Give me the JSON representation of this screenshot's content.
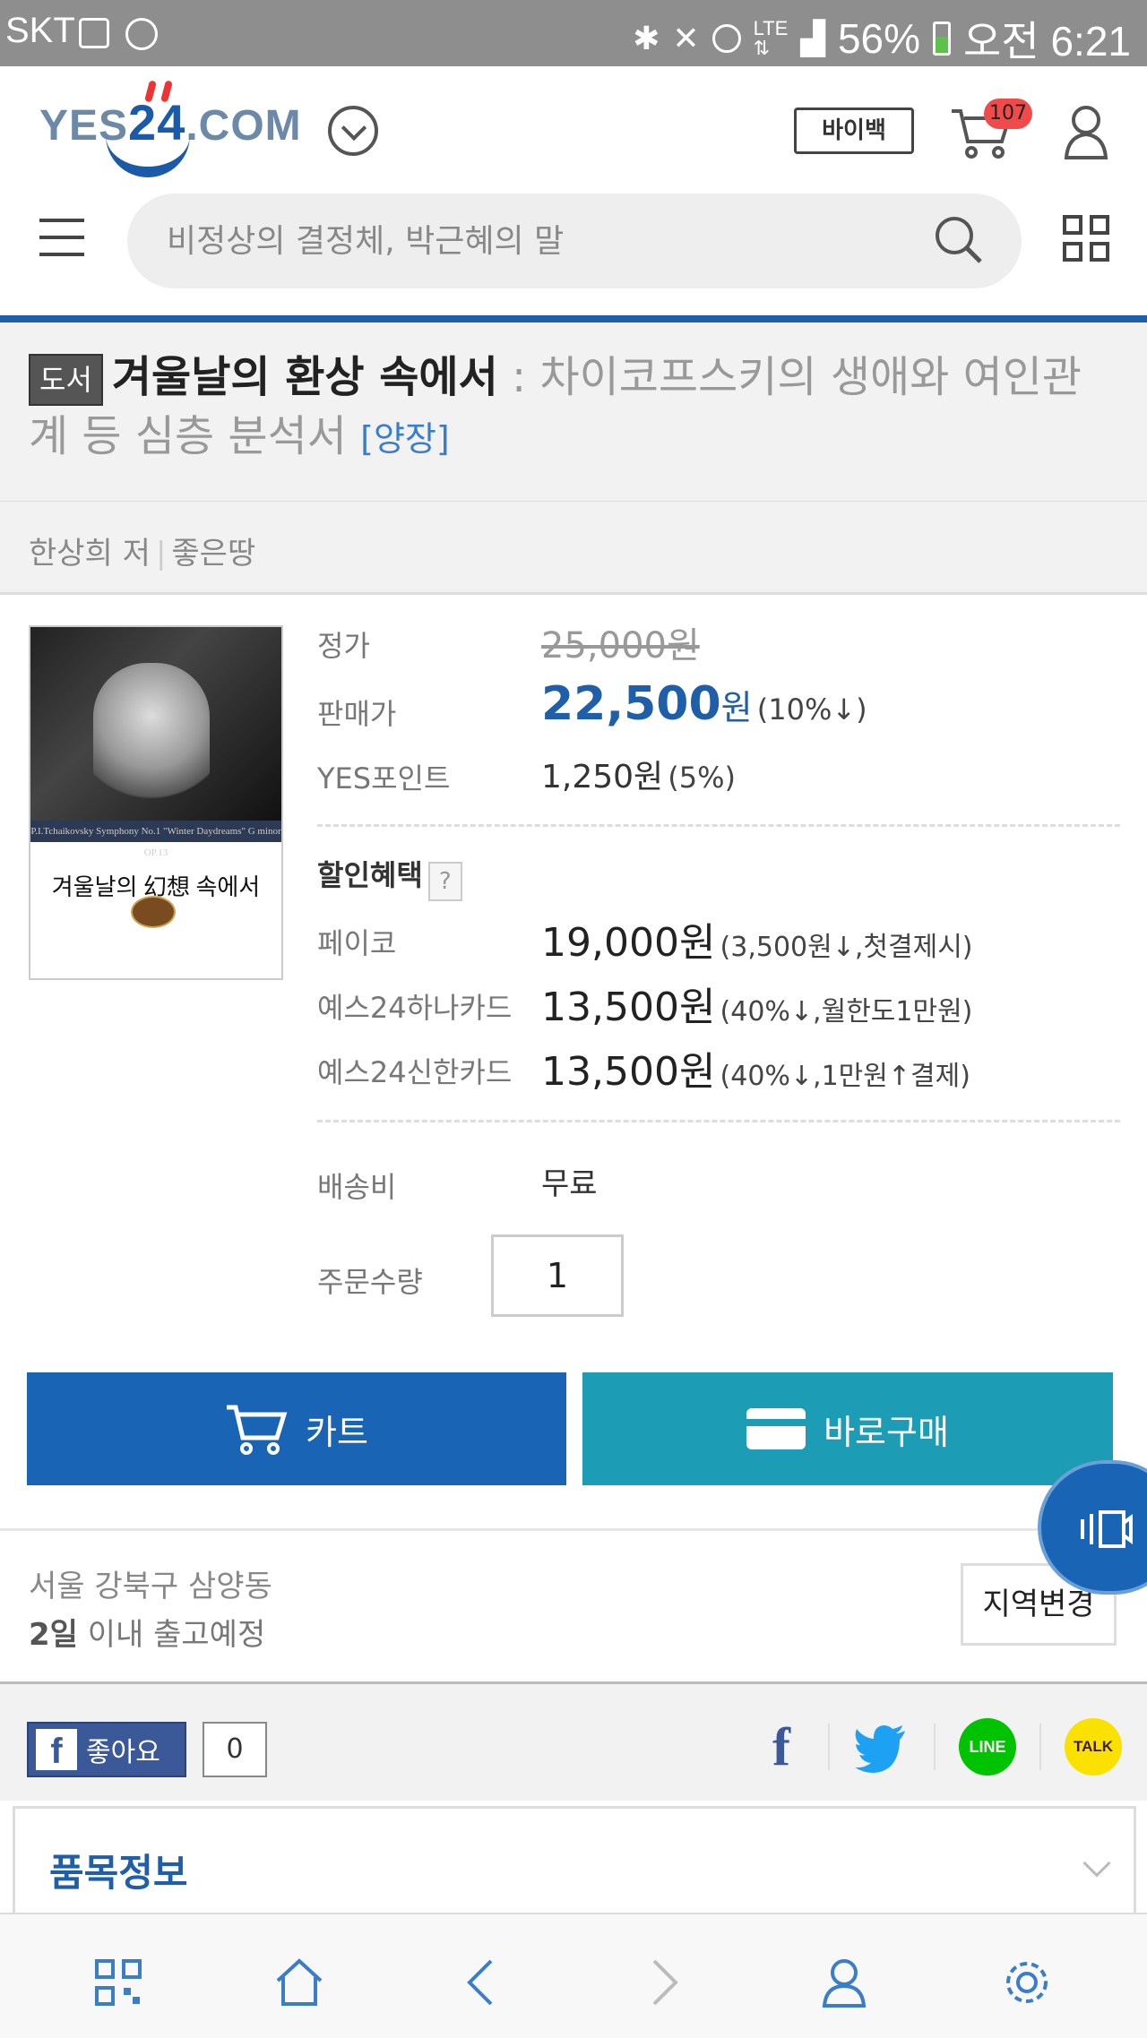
{
  "status_bar": {
    "carrier": "SKT",
    "battery": "56%",
    "time": "오전 6:21"
  },
  "header": {
    "logo_text_left": "YES",
    "logo_number": "24",
    "logo_text_right": ".COM",
    "buyback_label": "바이백",
    "cart_count": "107",
    "search_placeholder": "비정상의 결정체, 박근혜의 말"
  },
  "product": {
    "category_tag": "도서",
    "title": "겨울날의 환상 속에서",
    "subtitle": " : 차이코프스키의 생애와 여인관계 등 심층 분석서",
    "binding": "[양장]",
    "author": "한상희 저",
    "separator": "|",
    "publisher": "좋은땅",
    "cover": {
      "strip_text": "P.I.Tchaikovsky Symphony No.1 \"Winter Daydreams\" G minor OP.13",
      "title": "겨울날의 幻想 속에서"
    }
  },
  "pricing": {
    "list_price_label": "정가",
    "list_price": "25,000원",
    "sale_price_label": "판매가",
    "sale_price": "22,500",
    "sale_unit": "원",
    "sale_discount": "(10%↓)",
    "points_label": "YES포인트",
    "points": "1,250원",
    "points_rate": "(5%)",
    "benefits_label": "할인혜택",
    "benefits_help": "?",
    "benefits": [
      {
        "label": "페이코",
        "price": "19,000원",
        "note": "(3,500원↓,첫결제시)"
      },
      {
        "label": "예스24하나카드",
        "price": "13,500원",
        "note": "(40%↓,월한도1만원)"
      },
      {
        "label": "예스24신한카드",
        "price": "13,500원",
        "note": "(40%↓,1만원↑결제)"
      }
    ],
    "shipping_label": "배송비",
    "shipping_value": "무료",
    "qty_label": "주문수량",
    "qty_value": "1"
  },
  "actions": {
    "cart_label": "카트",
    "buy_now_label": "바로구매"
  },
  "delivery": {
    "address": "서울 강북구 삼양동",
    "days_bold": "2일",
    "days_rest": " 이내 출고예정",
    "region_button": "지역변경"
  },
  "social": {
    "like_label": "좋아요",
    "like_count": "0"
  },
  "item_info": {
    "label": "품목정보"
  },
  "colors": {
    "brand_blue": "#1f5ea8",
    "teal": "#1d9db5",
    "cart_badge": "#f04a4a"
  }
}
